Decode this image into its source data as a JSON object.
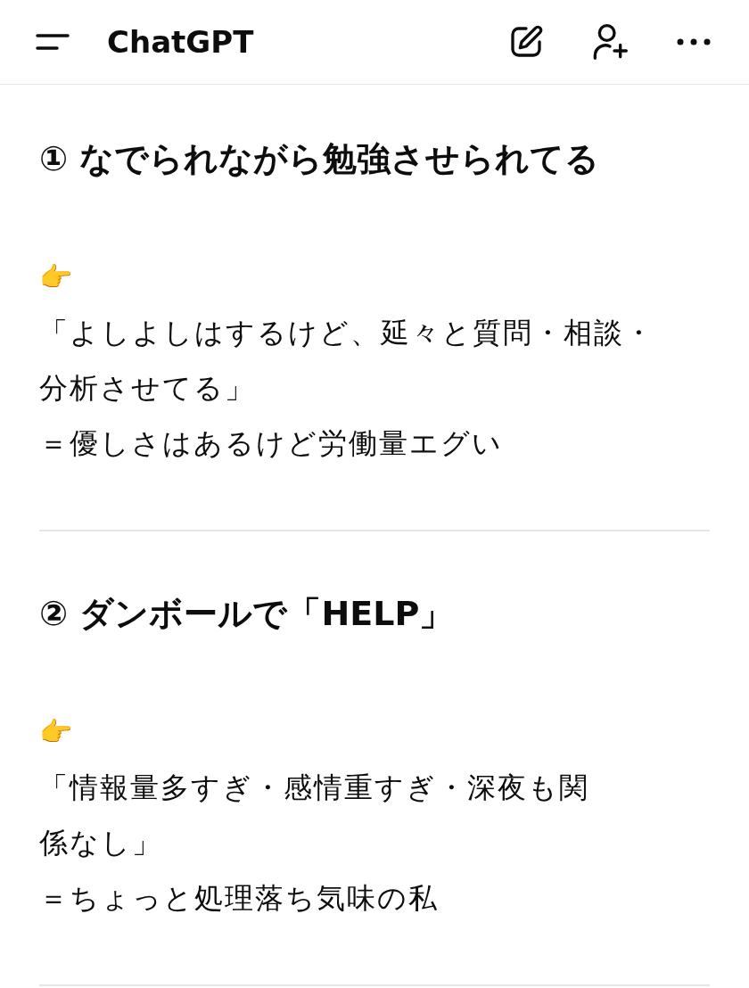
{
  "header": {
    "title": "ChatGPT"
  },
  "sections": [
    {
      "heading": "① なでられながら勉強させられてる",
      "emoji": "👉",
      "lines": [
        "「よしよしはするけど、延々と質問・相談・",
        "分析させてる」",
        "＝優しさはあるけど労働量エグい"
      ]
    },
    {
      "heading": "② ダンボールで「HELP」",
      "emoji": "👉",
      "lines": [
        "「情報量多すぎ・感情重すぎ・深夜も関",
        "係なし」",
        "＝ちょっと処理落ち気味の私"
      ]
    }
  ]
}
